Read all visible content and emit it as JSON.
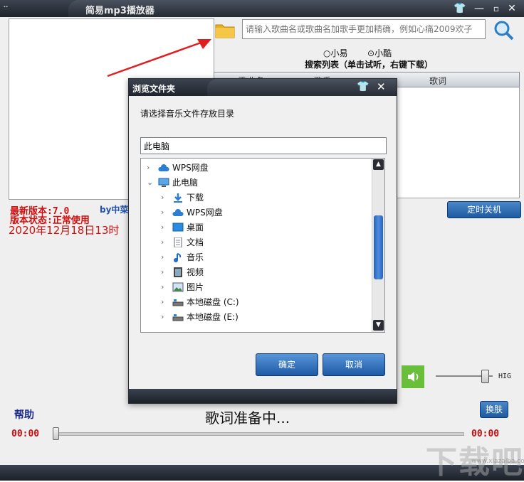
{
  "window": {
    "title": "简易mp3播放器",
    "buttons": {
      "skin": "👕",
      "minimize": "—",
      "close": "✕"
    }
  },
  "search": {
    "placeholder": "请输入歌曲名或歌曲名加歌手更加精确，例如心痛2009欢子",
    "source_options": [
      "小易",
      "小酷"
    ],
    "selected_source": "小酷",
    "list_label": "搜索列表（单击试听，右键下载）",
    "columns": [
      "歌曲名",
      "歌手",
      "歌词"
    ]
  },
  "info": {
    "latest_version": "最新版本:7.0",
    "status": "版本状态:正常使用",
    "date": "2020年12月18日13时",
    "author": "by中菜"
  },
  "controls": {
    "shutdown": "定时关机",
    "volume_label": "HIG",
    "volume_level": 0.85,
    "help": "帮助",
    "lyrics_status": "歌词准备中...",
    "skin": "换肤",
    "time_current": "00:00",
    "time_total": "00:00",
    "progress": 0
  },
  "dialog": {
    "title": "浏览文件夹",
    "prompt": "请选择音乐文件存放目录",
    "path_value": "此电脑",
    "tree": [
      {
        "label": "WPS网盘",
        "icon": "cloud-icon",
        "level": 0,
        "expanded": false
      },
      {
        "label": "此电脑",
        "icon": "computer-icon",
        "level": 0,
        "expanded": true
      },
      {
        "label": "下载",
        "icon": "download-icon",
        "level": 1,
        "expanded": false
      },
      {
        "label": "WPS网盘",
        "icon": "cloud-icon",
        "level": 1,
        "expanded": false
      },
      {
        "label": "桌面",
        "icon": "desktop-icon",
        "level": 1,
        "expanded": false
      },
      {
        "label": "文档",
        "icon": "document-icon",
        "level": 1,
        "expanded": false
      },
      {
        "label": "音乐",
        "icon": "music-icon",
        "level": 1,
        "expanded": false
      },
      {
        "label": "视频",
        "icon": "video-icon",
        "level": 1,
        "expanded": false
      },
      {
        "label": "图片",
        "icon": "picture-icon",
        "level": 1,
        "expanded": false
      },
      {
        "label": "本地磁盘 (C:)",
        "icon": "drive-icon",
        "level": 1,
        "expanded": false
      },
      {
        "label": "本地磁盘 (E:)",
        "icon": "drive-icon",
        "level": 1,
        "expanded": false
      }
    ],
    "ok": "确定",
    "cancel": "取消"
  },
  "watermark": {
    "text": "下载吧",
    "url": "www.xiazaiba.com"
  }
}
